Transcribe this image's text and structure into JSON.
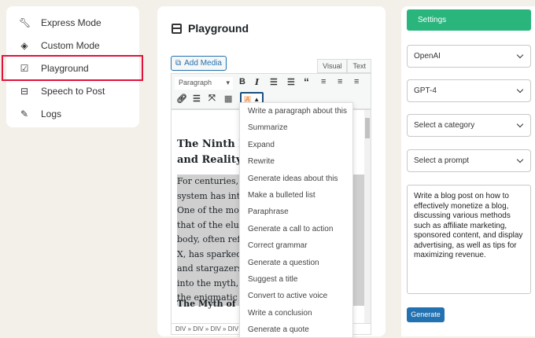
{
  "nav": [
    {
      "label": "Express Mode",
      "icon": "wrench-icon"
    },
    {
      "label": "Custom Mode",
      "icon": "layers-icon"
    },
    {
      "label": "Playground",
      "icon": "checkbox-icon"
    },
    {
      "label": "Speech to Post",
      "icon": "panel-icon"
    },
    {
      "label": "Logs",
      "icon": "feather-icon"
    }
  ],
  "playground": {
    "title": "Playground",
    "add_media": "Add Media",
    "tab_visual": "Visual",
    "tab_text": "Text",
    "format": "Paragraph",
    "heading": [
      "The Ninth Pl",
      "and Reality"
    ],
    "paragraph": [
      "For centuries, the",
      "system has intrig",
      "One of the most e",
      "that of the elusive",
      "body, often referr",
      "X, has sparked th",
      "and stargazers ali",
      "into the myth, my",
      "the enigmatic Nin"
    ],
    "subheading": "The Myth of Pla",
    "path": "DIV » DIV » DIV » DIV »"
  },
  "menu": [
    "Write a paragraph about this",
    "Summarize",
    "Expand",
    "Rewrite",
    "Generate ideas about this",
    "Make a bulleted list",
    "Paraphrase",
    "Generate a call to action",
    "Correct grammar",
    "Generate a question",
    "Suggest a title",
    "Convert to active voice",
    "Write a conclusion",
    "Generate a quote"
  ],
  "settings": {
    "label": "Settings",
    "provider": "OpenAI",
    "model": "GPT-4",
    "category": "Select a category",
    "prompt": "Select a prompt",
    "prompt_text": "Write a blog post on how to effectively monetize a blog, discussing various methods such as affiliate marketing, sponsored content, and display advertising, as well as tips for maximizing revenue.",
    "generate": "Generate",
    "accent": "#2ab57d",
    "button_color": "#2271b1"
  }
}
